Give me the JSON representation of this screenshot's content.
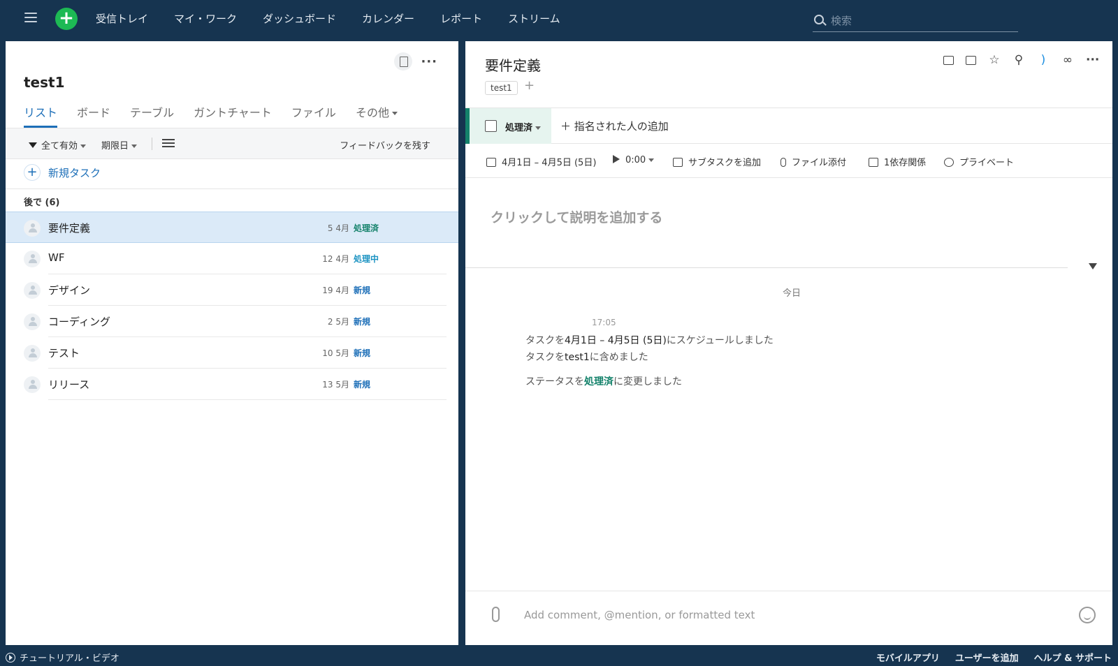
{
  "nav": {
    "items": [
      "受信トレイ",
      "マイ・ワーク",
      "ダッシュボード",
      "カレンダー",
      "レポート",
      "ストリーム"
    ],
    "search_placeholder": "検索"
  },
  "left": {
    "project_title": "test1",
    "tabs": [
      "リスト",
      "ボード",
      "テーブル",
      "ガントチャート",
      "ファイル",
      "その他"
    ],
    "filter": {
      "active": "全て有効",
      "due": "期限日",
      "feedback": "フィードバックを残す"
    },
    "new_task": "新規タスク",
    "group_label": "後で (6)",
    "tasks": [
      {
        "name": "要件定義",
        "date": "5 4月",
        "status": "処理済"
      },
      {
        "name": "WF",
        "date": "12 4月",
        "status": "処理中"
      },
      {
        "name": "デザイン",
        "date": "19 4月",
        "status": "新規"
      },
      {
        "name": "コーディング",
        "date": "2 5月",
        "status": "新規"
      },
      {
        "name": "テスト",
        "date": "10 5月",
        "status": "新規"
      },
      {
        "name": "リリース",
        "date": "13 5月",
        "status": "新規"
      }
    ]
  },
  "right": {
    "title": "要件定義",
    "tag": "test1",
    "tag_add": "+",
    "status": "処理済",
    "assign": "＋ 指名された人の追加",
    "meta": {
      "dates": "4月1日 – 4月5日 (5日)",
      "timer": "0:00",
      "subtask": "サブタスクを追加",
      "attach": "ファイル添付",
      "deps": "1依存関係",
      "privacy": "プライベート"
    },
    "description_placeholder": "クリックして説明を追加する",
    "activity": {
      "day": "今日",
      "time": "17:05",
      "line1_pre": "タスクを",
      "line1_bold": "4月1日 – 4月5日 (5日)",
      "line1_post": "にスケジュールしました",
      "line2_pre": "タスクを",
      "line2_bold": "test1",
      "line2_post": "に含めました",
      "line3_pre": "ステータスを",
      "line3_status": "処理済",
      "line3_post": "に変更しました"
    },
    "comment_placeholder": "Add comment, @mention, or formatted text"
  },
  "footer": {
    "tutorial": "チュートリアル・ビデオ",
    "mobile": "モバイルアプリ",
    "add_user": "ユーザーを追加",
    "help": "ヘルプ & サポート"
  },
  "colors": {
    "topbar": "#163450",
    "accent_blue": "#1d6fb8",
    "done_green": "#14826b",
    "progress_teal": "#1b93c2",
    "add_button": "#1db954"
  }
}
